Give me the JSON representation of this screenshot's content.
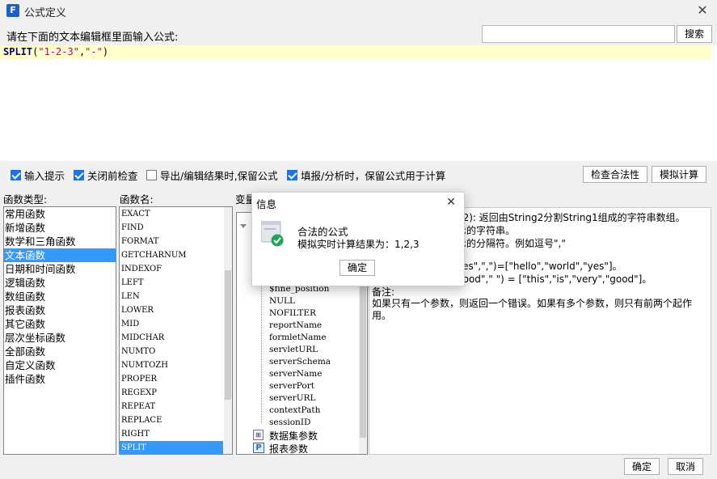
{
  "window": {
    "title": "公式定义",
    "app_icon_glyph": "F",
    "close_glyph": "✕"
  },
  "prompt": "请在下面的文本编辑框里面输入公式:",
  "search": {
    "value": "",
    "button": "搜索"
  },
  "formula": {
    "fn": "SPLIT",
    "open": "(",
    "arg1": "\"1-2-3\"",
    "comma": ",",
    "arg2": "\"-\"",
    "close": ")"
  },
  "options": [
    {
      "label": "输入提示",
      "checked": true
    },
    {
      "label": "关闭前检查",
      "checked": true
    },
    {
      "label": "导出/编辑结果时,保留公式",
      "checked": false
    },
    {
      "label": "填报/分析时，保留公式用于计算",
      "checked": true
    }
  ],
  "buttons": {
    "check_validity": "检查合法性",
    "simulate": "模拟计算",
    "ok": "确定",
    "cancel": "取消"
  },
  "panels": {
    "category_label": "函数类型:",
    "function_label": "函数名:",
    "variable_label": "变量"
  },
  "categories": [
    "常用函数",
    "新增函数",
    "数学和三角函数",
    "文本函数",
    "日期和时间函数",
    "逻辑函数",
    "数组函数",
    "报表函数",
    "其它函数",
    "层次坐标函数",
    "全部函数",
    "自定义函数",
    "插件函数"
  ],
  "selected_category": "文本函数",
  "functions": [
    "EXACT",
    "FIND",
    "FORMAT",
    "GETCHARNUM",
    "INDEXOF",
    "LEFT",
    "LEN",
    "LOWER",
    "MID",
    "MIDCHAR",
    "NUMTO",
    "NUMTOZH",
    "PROPER",
    "REGEXP",
    "REPEAT",
    "REPLACE",
    "RIGHT",
    "SPLIT"
  ],
  "selected_function": "SPLIT",
  "variables": [
    "$fine_position",
    "NULL",
    "NOFILTER",
    "reportName",
    "formletName",
    "servletURL",
    "serverSchema",
    "serverName",
    "serverPort",
    "serverURL",
    "contextPath",
    "sessionID"
  ],
  "variable_groups": {
    "dataset": "数据集参数",
    "report": "报表参数"
  },
  "description": {
    "line1": "g2): 返回由String2分割String1组成的字符串数组。",
    "line2": "示的字符串。",
    "line3": "示的分隔符。例如逗号\",\"",
    "line4": "yes\",\",\")=[\"hello\",\"world\",\"yes\"]。",
    "line5": "good\",\" \") = [\"this\",\"is\",\"very\",\"good\"]。",
    "note_title": "备注:",
    "note1": "如果只有一个参数，则返回一个错误。如果有多个参数，则只有前两个起作",
    "note2": "用。"
  },
  "dialog": {
    "title": "信息",
    "close_glyph": "✕",
    "heading": "合法的公式",
    "message": "模拟实时计算结果为：1,2,3",
    "ok": "确定"
  }
}
